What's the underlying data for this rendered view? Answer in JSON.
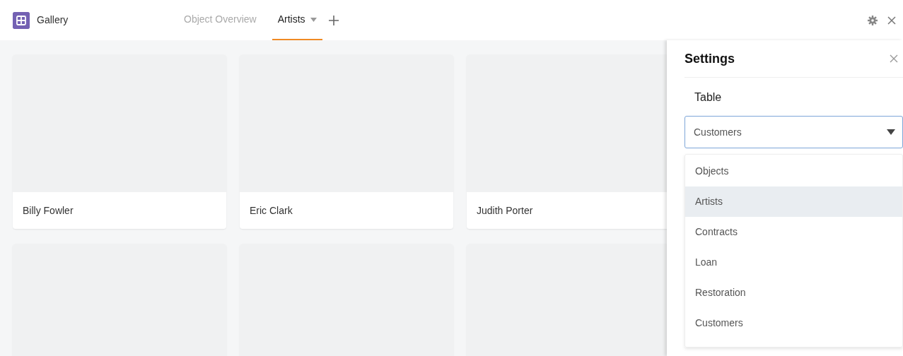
{
  "app": {
    "title": "Gallery"
  },
  "tabs": [
    {
      "label": "Object Overview",
      "selected": false,
      "has_menu": false
    },
    {
      "label": "Artists",
      "selected": true,
      "has_menu": true
    }
  ],
  "cards": [
    {
      "kind": "titled",
      "title": "Billy Fowler"
    },
    {
      "kind": "titled",
      "title": "Eric Clark"
    },
    {
      "kind": "titled",
      "title": "Judith Porter"
    },
    {
      "kind": "image_only"
    },
    {
      "kind": "image_only"
    },
    {
      "kind": "image_only"
    }
  ],
  "settings": {
    "title": "Settings",
    "field_label": "Table",
    "select_value": "Customers",
    "options": [
      {
        "label": "Objects",
        "highlighted": false
      },
      {
        "label": "Artists",
        "highlighted": true
      },
      {
        "label": "Contracts",
        "highlighted": false
      },
      {
        "label": "Loan",
        "highlighted": false
      },
      {
        "label": "Restoration",
        "highlighted": false
      },
      {
        "label": "Customers",
        "highlighted": false
      }
    ]
  }
}
